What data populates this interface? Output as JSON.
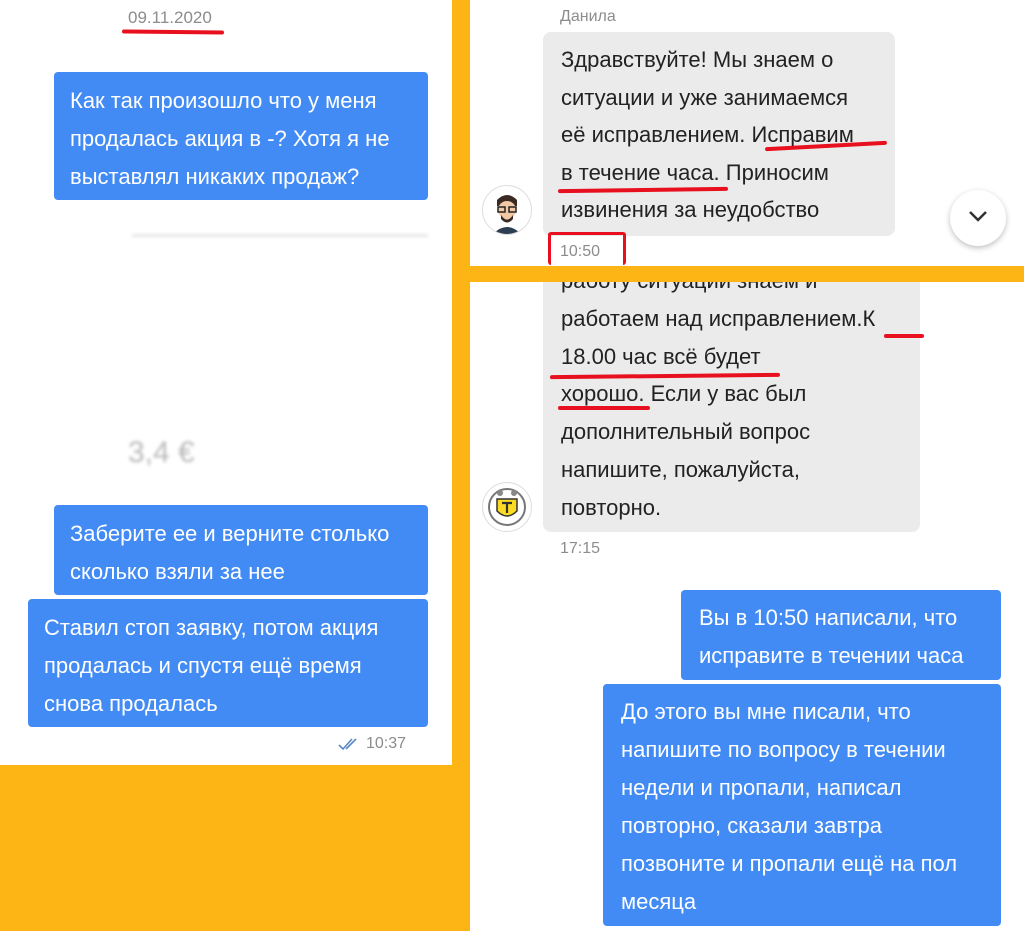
{
  "left_chat": {
    "date": "09.11.2020",
    "msg1": "Как так произошло что у меня продалась акция в -? Хотя я не выставлял никаких продаж?",
    "blurred_price": "3,4 €",
    "msg2": "Заберите ее и верните столько сколько взяли за нее",
    "msg3": "Ставил стоп заявку, потом акция продалась и спустя ещё время снова продалась",
    "time": "10:37",
    "status_icon": "double-check-icon"
  },
  "top_right_chat": {
    "sender": "Данила",
    "message_lines": [
      "Здравствуйте! Мы знаем о",
      "ситуации и уже занимаемся",
      "её исправлением. Исправим",
      "в течение часа. Приносим",
      "извинения за неудобство"
    ],
    "time": "10:50",
    "avatar_icon": "agent-avatar-icon",
    "scroll_icon": "chevron-down-icon"
  },
  "bottom_right_chat": {
    "partial_line": "работу ситуации знаем и",
    "message_lines": [
      "работаем над исправлением.К",
      "18.00 час всё будет",
      "хорошо. Если у вас был",
      "дополнительный вопрос",
      "напишите, пожалуйста,",
      "повторно."
    ],
    "time": "17:15",
    "avatar_icon": "bank-logo-icon",
    "reply1": "Вы в 10:50 написали, что исправите в течении часа",
    "reply2": "До этого вы мне писали, что напишите по вопросу в течении недели и пропали, написал повторно, сказали завтра позвоните и пропали ещё на пол месяца"
  },
  "colors": {
    "frame": "#FDB515",
    "outgoing": "#428BF5",
    "incoming": "#EBEBEB",
    "annotation": "#E8101E"
  }
}
